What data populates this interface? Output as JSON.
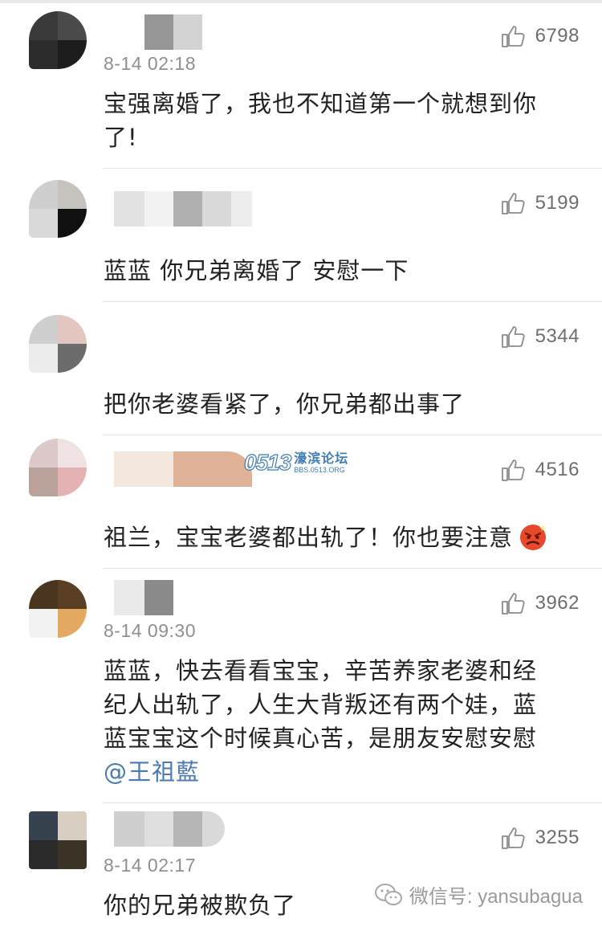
{
  "comments": [
    {
      "time": "8-14 02:18",
      "likes": "6798",
      "text": "宝强离婚了，我也不知道第一个就想到你了!"
    },
    {
      "time": "",
      "likes": "5199",
      "text": "蓝蓝 你兄弟离婚了 安慰一下"
    },
    {
      "time": "",
      "likes": "5344",
      "text": "把你老婆看紧了，你兄弟都出事了"
    },
    {
      "time": "",
      "likes": "4516",
      "text": "祖兰，宝宝老婆都出轨了！你也要注意",
      "emoji": "angry-face-icon"
    },
    {
      "time": "8-14 09:30",
      "likes": "3962",
      "text": "蓝蓝，快去看看宝宝，辛苦养家老婆和经纪人出轨了，人生大背叛还有两个娃，蓝蓝宝宝这个时候真心苦，是朋友安慰安慰",
      "mention": "@王祖藍"
    },
    {
      "time": "8-14 02:17",
      "likes": "3255",
      "text": "你的兄弟被欺负了"
    }
  ],
  "watermark": {
    "logo": "0513",
    "name": "濠滨论坛",
    "url": "BBS.0513.ORG"
  },
  "footer": {
    "wechat_label": "微信号: yansubagua"
  },
  "colors": {
    "mention": "#4a7ab3",
    "time": "#8f8f8f",
    "divider": "#e4e4e4"
  }
}
